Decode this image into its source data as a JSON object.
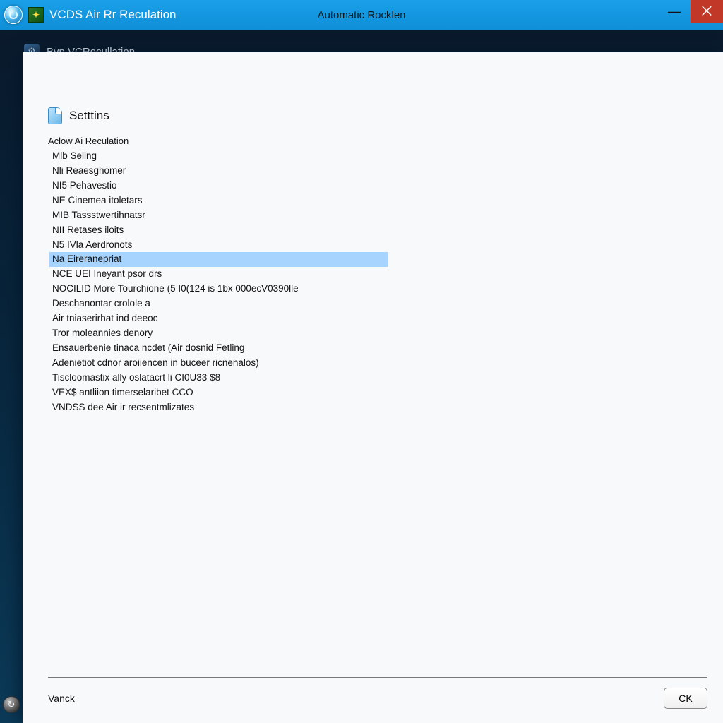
{
  "titlebar": {
    "app_title": "VCDS   Air Rr Reculation",
    "center_title": "Automatic Rocklen"
  },
  "win_controls": {
    "minimize": "—",
    "close": "⨉"
  },
  "frame": {
    "header_text": "Byp VCRecullation"
  },
  "panel": {
    "section_title": "Setttins",
    "subheading": "Aclow Ai Reculation",
    "selected_index": 7,
    "items": [
      "Mlb Seling",
      "Nli  Reaesghomer",
      "NI5   Pehavestio",
      "NE   Cinemea itoletars",
      "MIB  Tassstwertihnatsr",
      "NII   Retases iloits",
      "N5   IVla Aerdronots",
      "Na Eireranepriat",
      "NCE UEI Ineyant psor drs",
      "NOCILID More Tourchione (5 I0(124 is 1bx 000ecV0390lle",
      "Deschanontar crolole a",
      "Air tniaserirhat ind deeoc",
      "Tror moleannies denory",
      "Ensauerbenie tinaca  ncdet (Air dosnid Fetling",
      "Adenietiot cdnor aroiiencen in buceer ricnenalos)",
      "Tiscloomastix ally oslatacrt li CI0U33 $8",
      "VEX$ antliion timerselaribet CCO",
      "VNDSS dee Air ir recsentmlizates"
    ]
  },
  "footer": {
    "back_label": "Vanck",
    "ok_label": "CK"
  },
  "icons": {
    "app_glyph": "✦",
    "gear_glyph": "⚙",
    "corner_glyph": "↻"
  }
}
